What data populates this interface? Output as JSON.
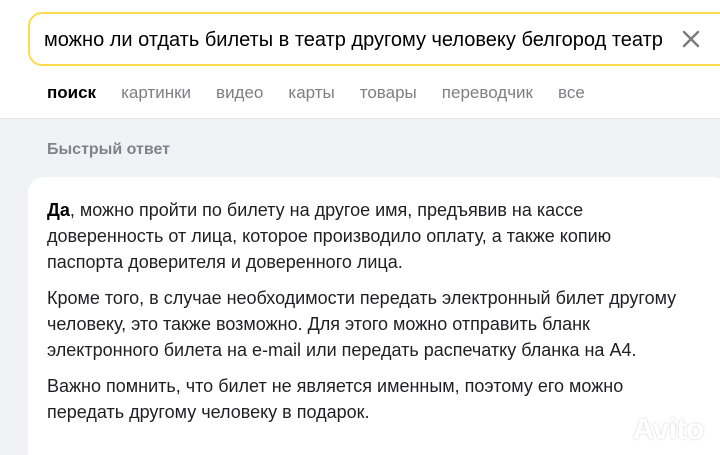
{
  "search": {
    "query": "можно ли отдать билеты в театр другому человеку белгород театр щ"
  },
  "tabs": [
    {
      "label": "поиск",
      "active": true
    },
    {
      "label": "картинки",
      "active": false
    },
    {
      "label": "видео",
      "active": false
    },
    {
      "label": "карты",
      "active": false
    },
    {
      "label": "товары",
      "active": false
    },
    {
      "label": "переводчик",
      "active": false
    },
    {
      "label": "все",
      "active": false
    }
  ],
  "quick_answer": {
    "title": "Быстрый ответ",
    "p1_bold": "Да",
    "p1_rest": ", можно пройти по билету на другое имя, предъявив на кассе доверенность от лица, которое производило оплату, а также копию паспорта доверителя и доверенного лица.",
    "p2": "Кроме того, в случае необходимости передать электронный билет другому человеку, это также возможно. Для этого можно отправить бланк электронного билета на e-mail или передать распечатку бланка на А4.",
    "p3": "Важно помнить, что билет не является именным, поэтому его можно передать другому человеку в подарок."
  },
  "watermark": {
    "text": "Avito",
    "icon": "avito-logo-icon"
  },
  "colors": {
    "search_border": "#ffdb4d",
    "background": "#f1f2f5",
    "tab_inactive": "#7e7e84"
  }
}
